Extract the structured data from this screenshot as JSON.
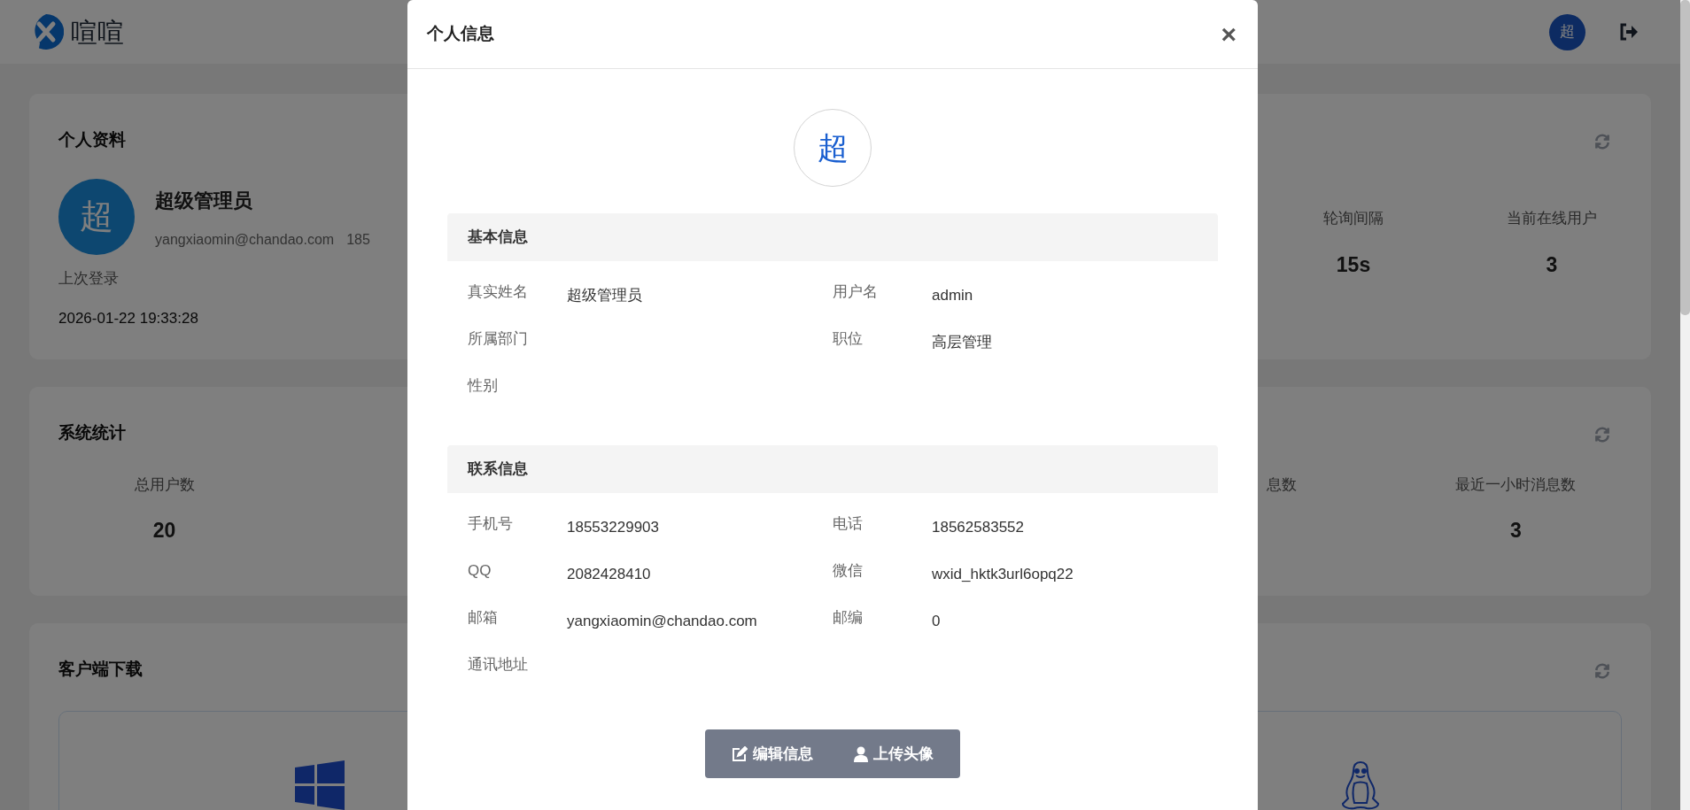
{
  "header": {
    "logo_text": "喧喧",
    "avatar": "超"
  },
  "profile_card": {
    "title": "个人资料",
    "avatar": "超",
    "name": "超级管理员",
    "email": "yangxiaomin@chandao.com",
    "phone_cut": "185",
    "last_login_label": "上次登录",
    "last_login": "2026-01-22 19:33:28",
    "stats": [
      {
        "label": "轮询间隔",
        "value": "15s"
      },
      {
        "label": "当前在线用户",
        "value": "3"
      }
    ]
  },
  "stats_card": {
    "title": "系统统计",
    "cut_label": "息数",
    "stats": [
      {
        "label": "总用户数",
        "value": "20"
      },
      {
        "label": "最近一小时消息数",
        "value": "3"
      }
    ]
  },
  "download_card": {
    "title": "客户端下载"
  },
  "modal": {
    "title": "个人信息",
    "close": "×",
    "avatar": "超",
    "sections": [
      {
        "title": "基本信息",
        "fields": [
          {
            "label": "真实姓名",
            "value": "超级管理员"
          },
          {
            "label": "用户名",
            "value": "admin"
          },
          {
            "label": "所属部门"
          },
          {
            "label": "职位",
            "value": "高层管理"
          },
          {
            "label": "性别"
          }
        ]
      },
      {
        "title": "联系信息",
        "fields": [
          {
            "label": "手机号",
            "value": "18553229903"
          },
          {
            "label": "电话",
            "value": "18562583552"
          },
          {
            "label": "QQ",
            "value": "2082428410"
          },
          {
            "label": "微信",
            "value": "wxid_hktk3url6opq22"
          },
          {
            "label": "邮箱",
            "value": "yangxiaomin@chandao.com"
          },
          {
            "label": "邮编",
            "value": "0"
          },
          {
            "label": "通讯地址"
          }
        ]
      }
    ],
    "buttons": [
      {
        "label": "编辑信息",
        "kind": "edit"
      },
      {
        "label": "上传头像",
        "kind": "user"
      }
    ]
  }
}
